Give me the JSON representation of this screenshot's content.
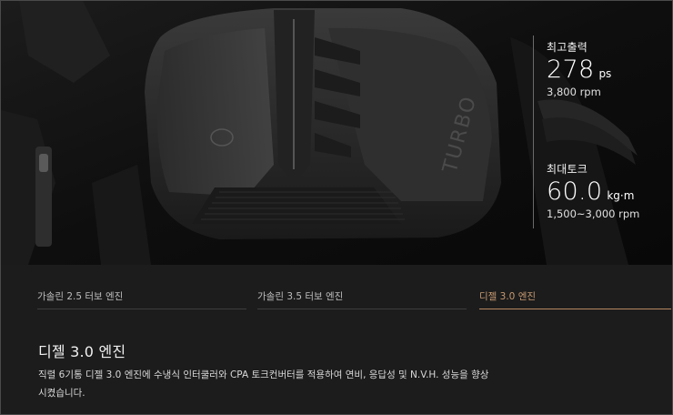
{
  "specs": {
    "power": {
      "label": "최고출력",
      "value": "278",
      "unit": "ps",
      "sub": "3,800 rpm"
    },
    "torque": {
      "label": "최대토크",
      "value": "60.0",
      "unit": "kg·m",
      "sub": "1,500~3,000 rpm"
    }
  },
  "engine_cover_text": "TURBO",
  "tabs": [
    {
      "label": "가솔린 2.5 터보 엔진",
      "active": false
    },
    {
      "label": "가솔린 3.5 터보 엔진",
      "active": false
    },
    {
      "label": "디젤 3.0 엔진",
      "active": true
    }
  ],
  "section": {
    "title": "디젤 3.0 엔진",
    "description": "직렬 6기통 디젤 3.0 엔진에 수냉식 인터쿨러와 CPA 토크컨버터를 적용하여 연비, 응답성 및 N.V.H. 성능을 향상시켰습니다."
  },
  "colors": {
    "accent": "#c79a72",
    "background": "#1c1c1c",
    "hero": "#111111"
  }
}
